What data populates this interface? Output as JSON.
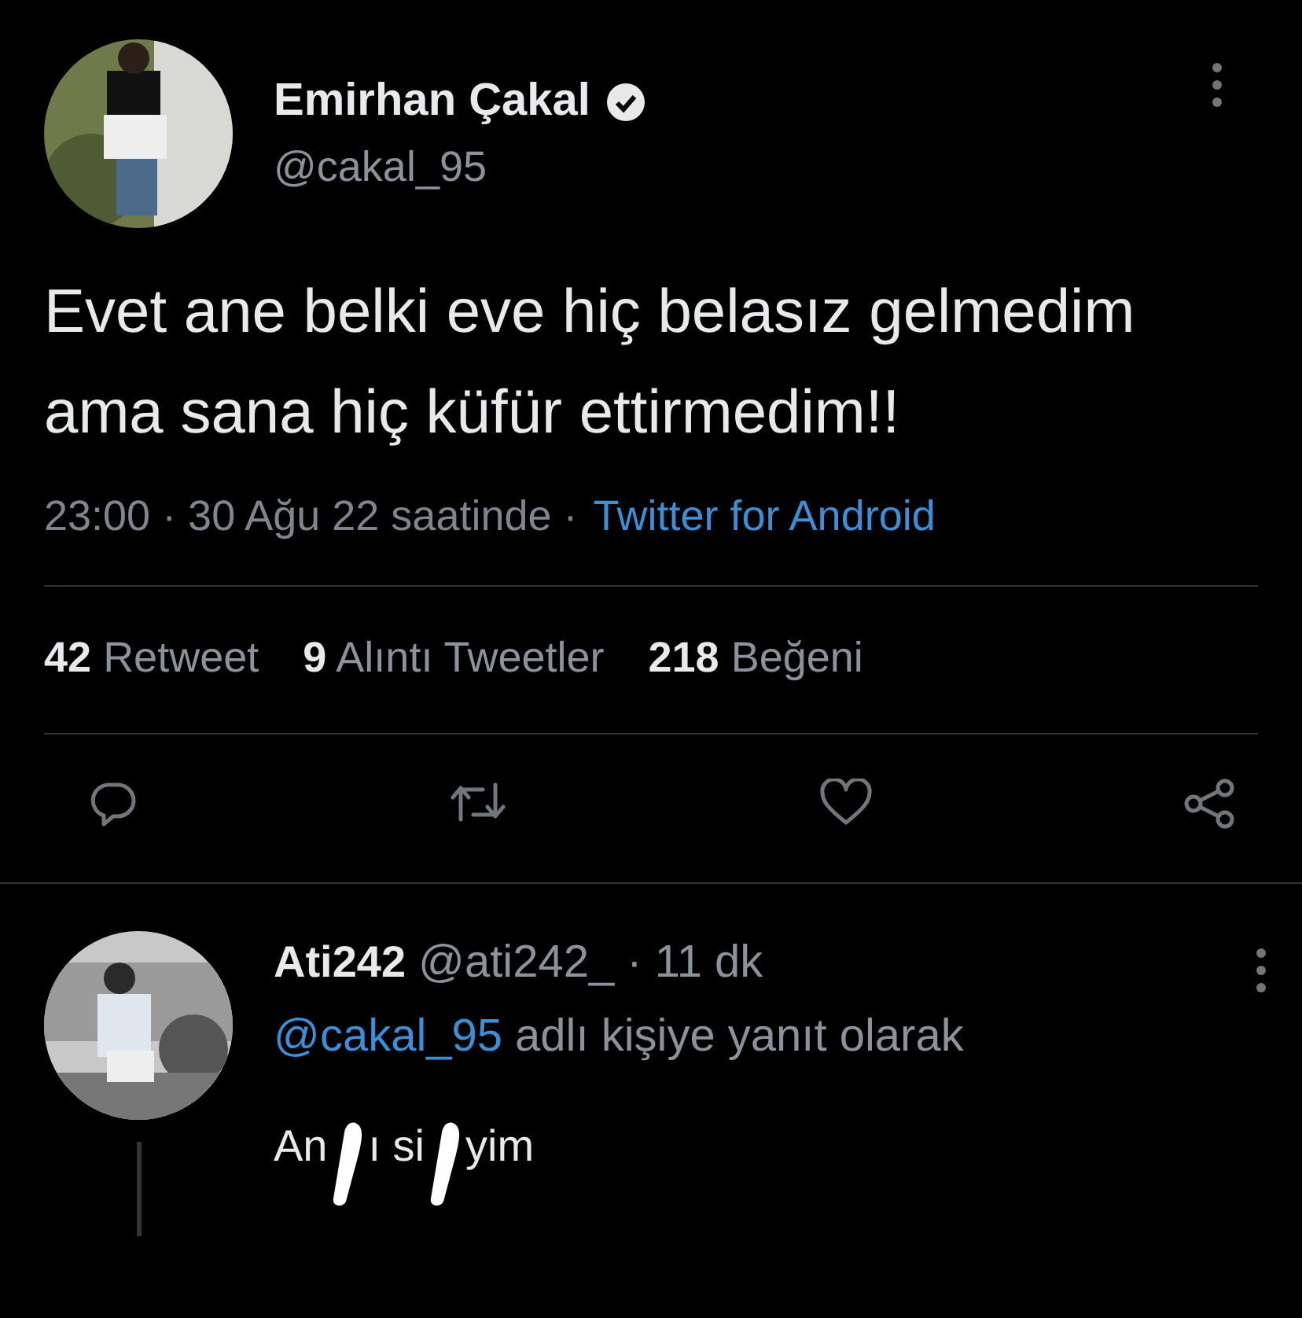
{
  "tweet": {
    "author": {
      "name": "Emirhan Çakal",
      "verified": true,
      "handle": "@cakal_95",
      "avatar": {
        "kind": "picture"
      }
    },
    "text": "Evet ane belki eve hiç belasız gelmedim ama sana hiç küfür ettirmedim!!",
    "time": "23:00 · 30 Ağu 22 saatinde ·",
    "source": "Twitter for Android",
    "stats": [
      {
        "count": "42",
        "label": "Retweet"
      },
      {
        "count": "9",
        "label": "Alıntı Tweetler"
      },
      {
        "count": "218",
        "label": "Beğeni"
      }
    ],
    "actions": [
      {
        "kind": "reply"
      },
      {
        "kind": "retweet"
      },
      {
        "kind": "like"
      },
      {
        "kind": "share"
      }
    ]
  },
  "reply": {
    "name": "Ati242",
    "handle": "@ati242_",
    "time": "· 11 dk",
    "avatar": {
      "kind": "picture"
    },
    "reply_to_mention": "@cakal_95",
    "reply_to_text": "adlı kişiye yanıt olarak",
    "text_parts": [
      "An",
      "ı si",
      "yim"
    ]
  }
}
